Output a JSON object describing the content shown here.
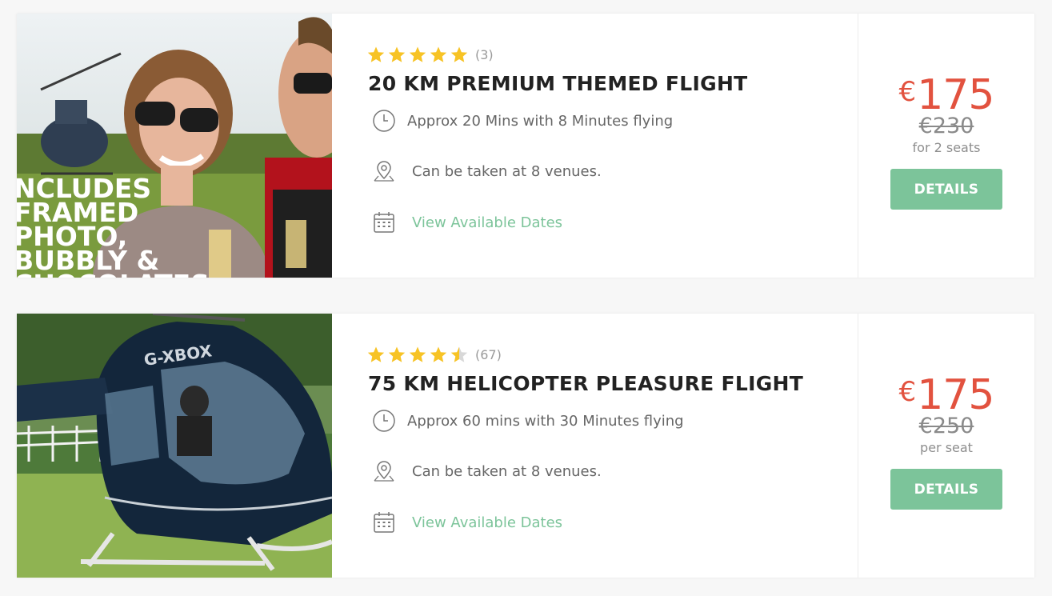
{
  "listings": [
    {
      "rating": 5,
      "review_count": "(3)",
      "title": "20 KM PREMIUM THEMED FLIGHT",
      "duration": "Approx 20 Mins with 8 Minutes flying",
      "venues": "Can be taken at 8 venues.",
      "dates_link": "View Available Dates",
      "currency": "€",
      "price": "175",
      "old_price": "€230",
      "price_unit": "for 2 seats",
      "details_label": "DETAILS",
      "photo_overlay_lines": [
        "NCLUDES",
        "FRAMED",
        "PHOTO,",
        "BUBBLY &",
        "CHOCOLATES"
      ]
    },
    {
      "rating": 4.5,
      "review_count": "(67)",
      "title": "75 KM HELICOPTER PLEASURE FLIGHT",
      "duration": "Approx 60 mins with 30 Minutes flying",
      "venues": "Can be taken at 8 venues.",
      "dates_link": "View Available Dates",
      "currency": "€",
      "price": "175",
      "old_price": "€250",
      "price_unit": "per seat",
      "details_label": "DETAILS",
      "photo_registration": "G-XBOX"
    }
  ],
  "colors": {
    "star": "#f7c325",
    "star_empty": "#d8d8d8",
    "price": "#e2523f",
    "accent": "#7cc49a",
    "title": "#222222"
  },
  "icons": {
    "duration": "clock-icon",
    "venues": "map-pin-icon",
    "dates": "calendar-icon",
    "rating": "star-icon"
  }
}
